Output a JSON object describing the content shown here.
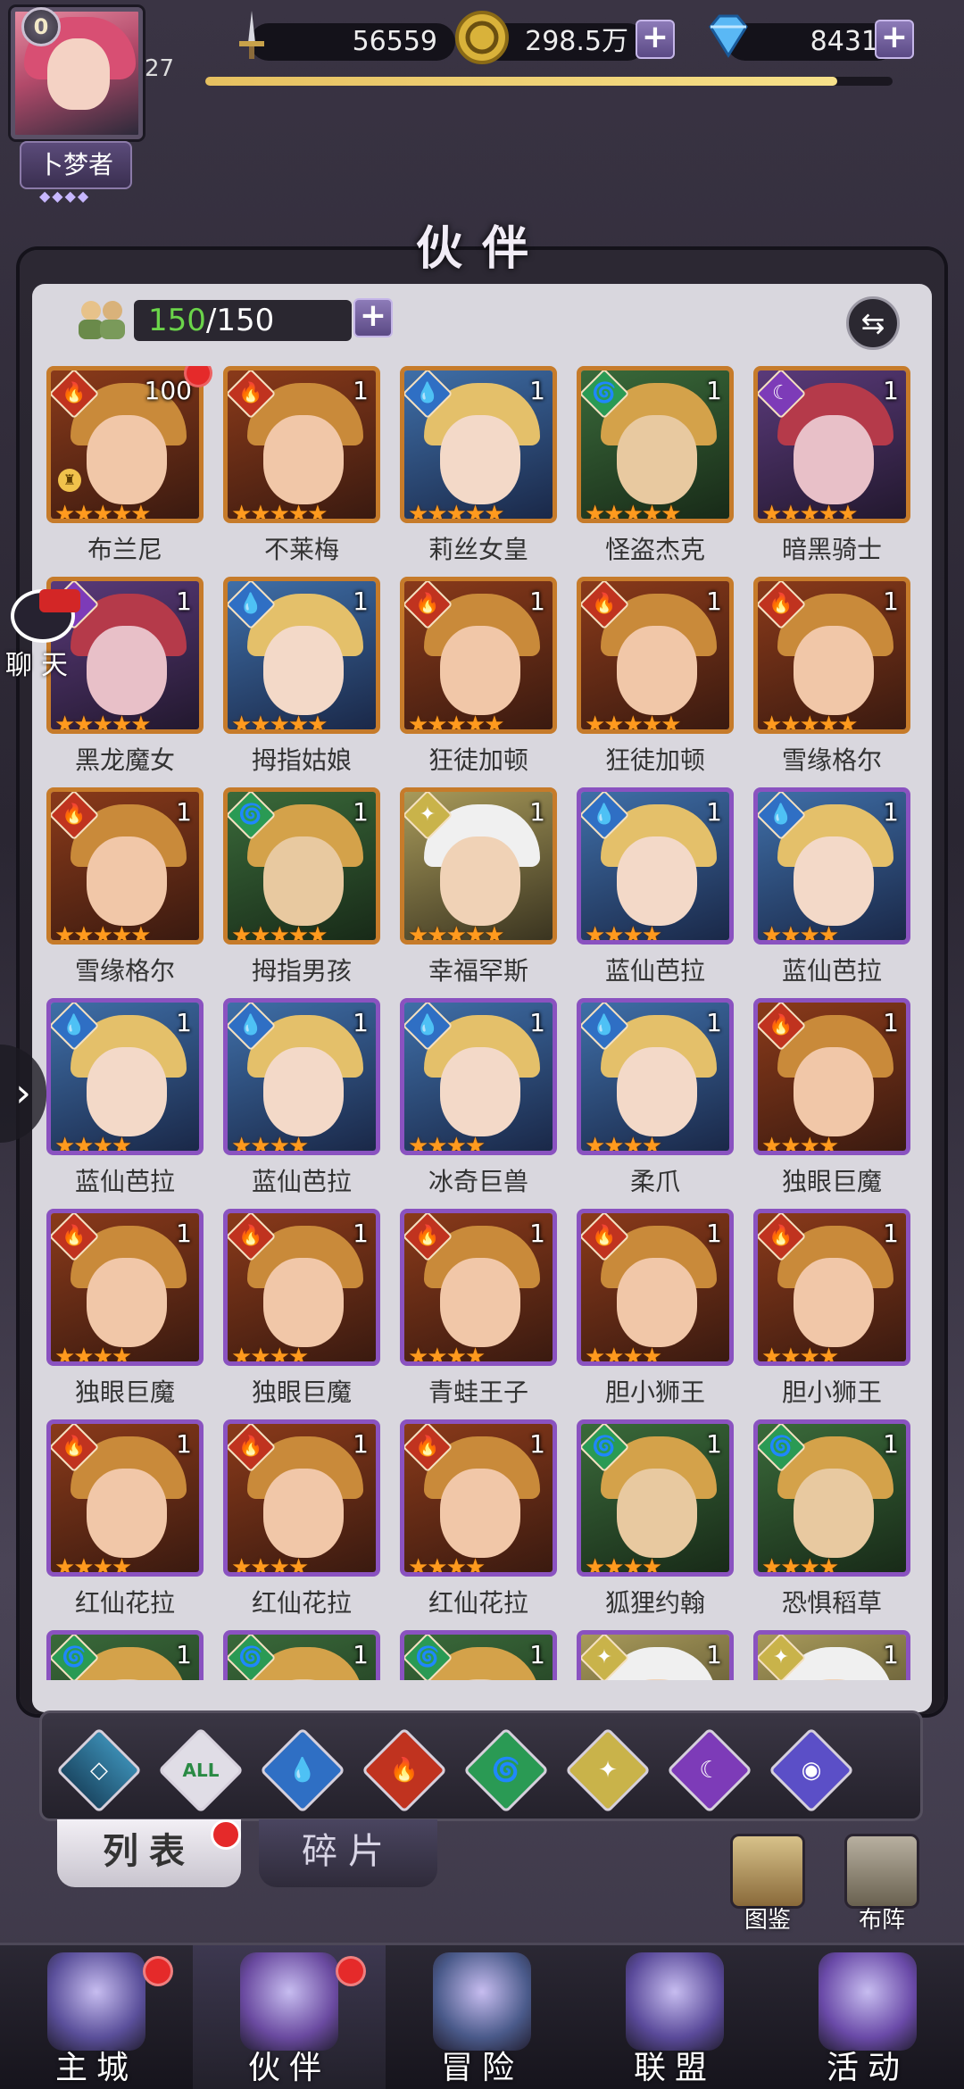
{
  "player": {
    "vip": "0",
    "level": "27",
    "name": "卜梦者",
    "name_dots": "◆◆◆◆",
    "xp_progress": 0.92
  },
  "resources": {
    "power": "56559",
    "gold": "298.5万",
    "gems": "8431",
    "plus": "+"
  },
  "title": "伙伴",
  "roster": {
    "current": "150",
    "max": "/150",
    "plus": "+",
    "swap_icon": "⇆"
  },
  "chat": {
    "label": "聊天"
  },
  "element_glyphs": {
    "fire": "🔥",
    "water": "💧",
    "nature": "🌀",
    "light": "✦",
    "dark": "☾"
  },
  "cards": [
    {
      "name": "布兰尼",
      "level": "100",
      "element": "fire",
      "frame": "gold",
      "stars": 5,
      "red_dot": true,
      "badge": true
    },
    {
      "name": "不莱梅",
      "level": "1",
      "element": "fire",
      "frame": "gold",
      "stars": 5
    },
    {
      "name": "莉丝女皇",
      "level": "1",
      "element": "water",
      "frame": "gold",
      "stars": 5
    },
    {
      "name": "怪盗杰克",
      "level": "1",
      "element": "nature",
      "frame": "gold",
      "stars": 5
    },
    {
      "name": "暗黑骑士",
      "level": "1",
      "element": "dark",
      "frame": "gold",
      "stars": 5
    },
    {
      "name": "黑龙魔女",
      "level": "1",
      "element": "dark",
      "frame": "gold",
      "stars": 5
    },
    {
      "name": "拇指姑娘",
      "level": "1",
      "element": "water",
      "frame": "gold",
      "stars": 5
    },
    {
      "name": "狂徒加顿",
      "level": "1",
      "element": "fire",
      "frame": "gold",
      "stars": 5
    },
    {
      "name": "狂徒加顿",
      "level": "1",
      "element": "fire",
      "frame": "gold",
      "stars": 5
    },
    {
      "name": "雪缘格尔",
      "level": "1",
      "element": "fire",
      "frame": "gold",
      "stars": 5
    },
    {
      "name": "雪缘格尔",
      "level": "1",
      "element": "fire",
      "frame": "gold",
      "stars": 5
    },
    {
      "name": "拇指男孩",
      "level": "1",
      "element": "nature",
      "frame": "gold",
      "stars": 5
    },
    {
      "name": "幸福罕斯",
      "level": "1",
      "element": "light",
      "frame": "gold",
      "stars": 5
    },
    {
      "name": "蓝仙芭拉",
      "level": "1",
      "element": "water",
      "frame": "purple",
      "stars": 4
    },
    {
      "name": "蓝仙芭拉",
      "level": "1",
      "element": "water",
      "frame": "purple",
      "stars": 4
    },
    {
      "name": "蓝仙芭拉",
      "level": "1",
      "element": "water",
      "frame": "purple",
      "stars": 4
    },
    {
      "name": "蓝仙芭拉",
      "level": "1",
      "element": "water",
      "frame": "purple",
      "stars": 4
    },
    {
      "name": "冰奇巨兽",
      "level": "1",
      "element": "water",
      "frame": "purple",
      "stars": 4
    },
    {
      "name": "柔爪",
      "level": "1",
      "element": "water",
      "frame": "purple",
      "stars": 4
    },
    {
      "name": "独眼巨魔",
      "level": "1",
      "element": "fire",
      "frame": "purple",
      "stars": 4
    },
    {
      "name": "独眼巨魔",
      "level": "1",
      "element": "fire",
      "frame": "purple",
      "stars": 4
    },
    {
      "name": "独眼巨魔",
      "level": "1",
      "element": "fire",
      "frame": "purple",
      "stars": 4
    },
    {
      "name": "青蛙王子",
      "level": "1",
      "element": "fire",
      "frame": "purple",
      "stars": 4
    },
    {
      "name": "胆小狮王",
      "level": "1",
      "element": "fire",
      "frame": "purple",
      "stars": 4
    },
    {
      "name": "胆小狮王",
      "level": "1",
      "element": "fire",
      "frame": "purple",
      "stars": 4
    },
    {
      "name": "红仙花拉",
      "level": "1",
      "element": "fire",
      "frame": "purple",
      "stars": 4
    },
    {
      "name": "红仙花拉",
      "level": "1",
      "element": "fire",
      "frame": "purple",
      "stars": 4
    },
    {
      "name": "红仙花拉",
      "level": "1",
      "element": "fire",
      "frame": "purple",
      "stars": 4
    },
    {
      "name": "狐狸约翰",
      "level": "1",
      "element": "nature",
      "frame": "purple",
      "stars": 4
    },
    {
      "name": "恐惧稻草",
      "level": "1",
      "element": "nature",
      "frame": "purple",
      "stars": 4
    },
    {
      "name": "",
      "level": "1",
      "element": "nature",
      "frame": "purple",
      "stars": 4
    },
    {
      "name": "",
      "level": "1",
      "element": "nature",
      "frame": "purple",
      "stars": 4
    },
    {
      "name": "",
      "level": "1",
      "element": "nature",
      "frame": "purple",
      "stars": 4
    },
    {
      "name": "",
      "level": "1",
      "element": "light",
      "frame": "purple",
      "stars": 4
    },
    {
      "name": "",
      "level": "1",
      "element": "light",
      "frame": "purple",
      "stars": 4
    }
  ],
  "filters": [
    {
      "id": "first",
      "label": "◇"
    },
    {
      "id": "all",
      "label": "ALL"
    },
    {
      "id": "water",
      "label": "💧"
    },
    {
      "id": "fire",
      "label": "🔥"
    },
    {
      "id": "nature",
      "label": "🌀"
    },
    {
      "id": "light",
      "label": "✦"
    },
    {
      "id": "dark",
      "label": "☾"
    },
    {
      "id": "cosmic",
      "label": "◉"
    }
  ],
  "tabs": {
    "list": "列表",
    "fragments": "碎片"
  },
  "side_buttons": {
    "codex": "图鉴",
    "formation": "布阵"
  },
  "nav": [
    {
      "label": "主城",
      "red_dot": true
    },
    {
      "label": "伙伴",
      "red_dot": true,
      "active": true
    },
    {
      "label": "冒险",
      "red_dot": false
    },
    {
      "label": "联盟",
      "red_dot": false
    },
    {
      "label": "活动",
      "red_dot": false
    }
  ],
  "edge_arrow": "›"
}
